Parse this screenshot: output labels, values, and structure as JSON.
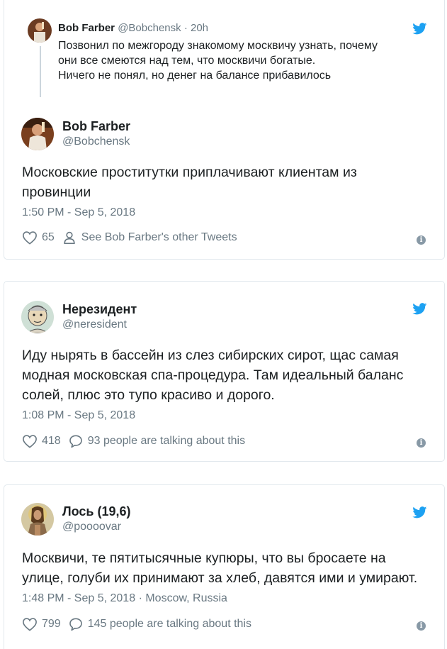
{
  "colors": {
    "twitter_blue": "#1da1f2",
    "secondary_text": "#697882",
    "border": "#e1e8ed"
  },
  "tweets": [
    {
      "quote": {
        "name": "Bob Farber",
        "handle": "@Bobchensk",
        "separator": "·",
        "time": "20h",
        "text_lines": [
          "Позвонил по межгороду знакомому москвичу узнать, почему",
          "они все смеются над тем, что москвичи богатые.",
          "Ничего не понял, но денег на балансе прибавилось"
        ]
      },
      "name": "Bob Farber",
      "handle": "@Bobchensk",
      "text_lines": [
        "Московские проститутки приплачивают клиентам из",
        "провинции"
      ],
      "timestamp": "1:50 PM - Sep 5, 2018",
      "likes": "65",
      "secondary_action": "See Bob Farber's other Tweets",
      "secondary_icon": "person-icon"
    },
    {
      "name": "Нерезидент",
      "handle": "@neresident",
      "text_lines": [
        "Иду нырять в бассейн из слез сибирских сирот, щас самая",
        "модная московская спа-процедура. Там идеальный баланс",
        "солей, плюс это тупо красиво и дорого."
      ],
      "timestamp": "1:08 PM - Sep 5, 2018",
      "likes": "418",
      "secondary_action": "93 people are talking about this",
      "secondary_icon": "speech-bubble-icon"
    },
    {
      "name": "Лось (19,6)",
      "handle": "@poooovar",
      "text_lines": [
        "Москвичи, те пятитысячные купюры, что вы бросаете на",
        "улице, голуби их принимают за хлеб, давятся ими и умирают."
      ],
      "timestamp": "1:48 PM - Sep 5, 2018",
      "location_separator": "·",
      "location": "Moscow, Russia",
      "likes": "799",
      "secondary_action": "145 people are talking about this",
      "secondary_icon": "speech-bubble-icon"
    }
  ]
}
